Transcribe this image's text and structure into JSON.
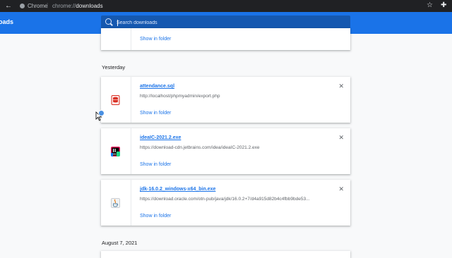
{
  "address_bar": {
    "site_label": "Chrome",
    "separator": "|",
    "url_scheme": "chrome://",
    "url_path": "downloads"
  },
  "toolbar": {
    "title": "oads",
    "search_placeholder": "Search downloads"
  },
  "top_card": {
    "show_in_folder": "Show in folder"
  },
  "groups": [
    {
      "date": "Yesterday",
      "items": [
        {
          "filename": "attendance.sql",
          "url": "http://localhost/phpmyadmin/export.php",
          "action": "Show in folder",
          "icon": "sql-file-icon"
        },
        {
          "filename": "ideaIC-2021.2.exe",
          "url": "https://download-cdn.jetbrains.com/idea/ideaIC-2021.2.exe",
          "action": "Show in folder",
          "icon": "intellij-idea-icon"
        },
        {
          "filename": "jdk-16.0.2_windows-x64_bin.exe",
          "url": "https://download.oracle.com/otn-pub/java/jdk/16.0.2+7/d4a915d82b4c4fbb9bde53...",
          "action": "Show in folder",
          "icon": "java-icon"
        }
      ]
    },
    {
      "date": "August 7, 2021",
      "items": []
    }
  ],
  "colors": {
    "accent": "#1a73e8",
    "toolbar": "#1a73e8",
    "address_bar": "#202124"
  }
}
